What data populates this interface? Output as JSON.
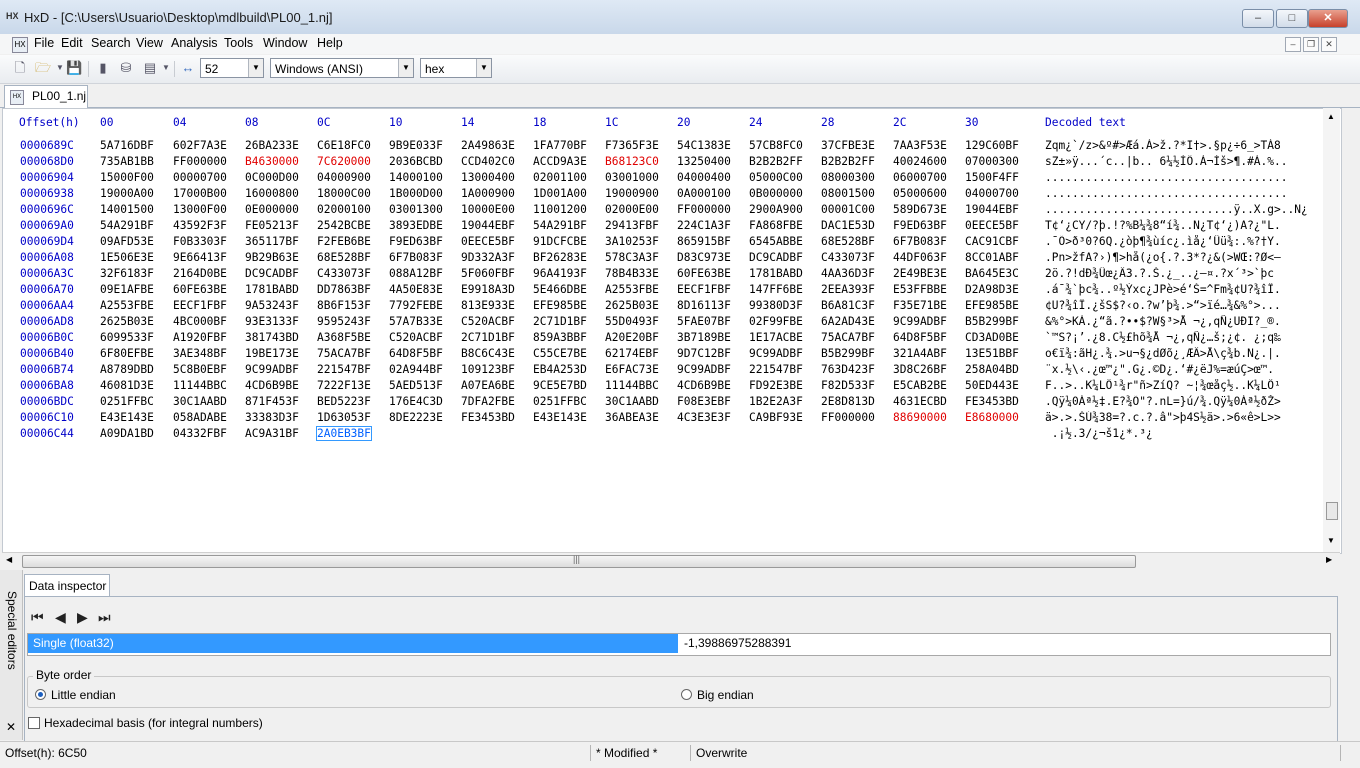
{
  "window": {
    "title": "HxD - [C:\\Users\\Usuario\\Desktop\\mdlbuild\\PL00_1.nj]",
    "minimize": "–",
    "maximize": "□",
    "close": "✕"
  },
  "menu": [
    "File",
    "Edit",
    "Search",
    "View",
    "Analysis",
    "Tools",
    "Window",
    "Help"
  ],
  "toolbar": {
    "bytes_per_row": "52",
    "charset": "Windows (ANSI)",
    "offset_base": "hex"
  },
  "tab": {
    "label": "PL00_1.nj"
  },
  "hex": {
    "offset_header": "Offset(h)",
    "column_headers": [
      "00",
      "04",
      "08",
      "0C",
      "10",
      "14",
      "18",
      "1C",
      "20",
      "24",
      "28",
      "2C",
      "30"
    ],
    "decoded_header": "Decoded text",
    "rows": [
      {
        "offset": "0000689C",
        "groups": [
          "5A716DBF",
          "602F7A3E",
          "26BA233E",
          "C6E18FC0",
          "9B9E033F",
          "2A49863E",
          "1FA770BF",
          "F7365F3E",
          "54C1383E",
          "57CB8FC0",
          "37CFBE3E",
          "7AA3F53E",
          "129C60BF"
        ],
        "decoded": "Zqm¿`/z>&º#>Æá.À>ž.?*I†>.§p¿÷6_>TÁ8",
        "red": []
      },
      {
        "offset": "000068D0",
        "groups": [
          "735AB1BB",
          "FF000000",
          "B4630000",
          "7C620000",
          "2036BCBD",
          "CCD402C0",
          "ACCD9A3E",
          "B68123C0",
          "13250400",
          "B2B2B2FF",
          "B2B2B2FF",
          "40024600",
          "07000300"
        ],
        "decoded": "sZ±»ÿ...´c..|b.. 6¼½ÌÔ.À¬Íš>¶.#À.%..",
        "red": [
          2,
          3,
          7
        ]
      },
      {
        "offset": "00006904",
        "groups": [
          "15000F00",
          "00000700",
          "0C000D00",
          "04000900",
          "14000100",
          "13000400",
          "02001100",
          "03001000",
          "04000400",
          "05000C00",
          "08000300",
          "06000700",
          "1500F4FF"
        ],
        "decoded": "....................................",
        "red": []
      },
      {
        "offset": "00006938",
        "groups": [
          "19000A00",
          "17000B00",
          "16000800",
          "18000C00",
          "1B000D00",
          "1A000900",
          "1D001A00",
          "19000900",
          "0A000100",
          "0B000000",
          "08001500",
          "05000600",
          "04000700"
        ],
        "decoded": "....................................",
        "red": []
      },
      {
        "offset": "0000696C",
        "groups": [
          "14001500",
          "13000F00",
          "0E000000",
          "02000100",
          "03001300",
          "10000E00",
          "11001200",
          "02000E00",
          "FF000000",
          "2900A900",
          "00001C00",
          "589D673E",
          "19044EBF"
        ],
        "decoded": "............................ÿ..X.g>..N¿",
        "red": []
      },
      {
        "offset": "000069A0",
        "groups": [
          "54A291BF",
          "43592F3F",
          "FE05213F",
          "2542BCBE",
          "3893EDBE",
          "19044EBF",
          "54A291BF",
          "29413FBF",
          "224C1A3F",
          "FA868FBE",
          "DAC1E53D",
          "F9ED63BF",
          "0EECE5BF"
        ],
        "decoded": "T¢‘¿CY/?þ.!?%B¼¾8“í¾..N¿T¢‘¿)A?¿\"L.",
        "red": []
      },
      {
        "offset": "000069D4",
        "groups": [
          "09AFD53E",
          "F0B3303F",
          "365117BF",
          "F2FEB6BE",
          "F9ED63BF",
          "0EECE5BF",
          "91DCFCBE",
          "3A10253F",
          "865915BF",
          "6545ABBE",
          "68E528BF",
          "6F7B083F",
          "CAC91CBF"
        ],
        "decoded": ".¯Õ>ð³0?6Q.¿òþ¶¾ùíc¿.ìå¿‘Üü¾:.%?†Y.",
        "red": []
      },
      {
        "offset": "00006A08",
        "groups": [
          "1E506E3E",
          "9E66413F",
          "9B29B63E",
          "68E528BF",
          "6F7B083F",
          "9D332A3F",
          "BF26283E",
          "578C3A3F",
          "D83C973E",
          "DC9CADBF",
          "C433073F",
          "44DF063F",
          "8CC01ABF"
        ],
        "decoded": ".Pn>žfA?›)¶>hå(¿o{.?.3*?¿&(>WŒ:?Ø<—",
        "red": []
      },
      {
        "offset": "00006A3C",
        "groups": [
          "32F6183F",
          "2164D0BE",
          "DC9CADBF",
          "C433073F",
          "088A12BF",
          "5F060FBF",
          "96A4193F",
          "78B4B33E",
          "60FE63BE",
          "1781BABD",
          "4AA36D3F",
          "2E49BE3E",
          "BA645E3C"
        ],
        "decoded": "2ö.?!dÐ¾Üœ­¿Ä3.?.Š.¿_..¿–¤.?x´³>`þc",
        "red": []
      },
      {
        "offset": "00006A70",
        "groups": [
          "09E1AFBE",
          "60FE63BE",
          "1781BABD",
          "DD7863BF",
          "4A50E83E",
          "E9918A3D",
          "5E466DBE",
          "A2553FBE",
          "EECF1FBF",
          "147FF6BE",
          "2EEA393F",
          "E53FFBBE",
          "D2A98D3E"
        ],
        "decoded": ".á¯¾`þc¾..º½Ýxc¿JPè>é‘Š=^Fm¾¢U?¾îÏ.",
        "red": []
      },
      {
        "offset": "00006AA4",
        "groups": [
          "A2553FBE",
          "EECF1FBF",
          "9A53243F",
          "8B6F153F",
          "7792FEBE",
          "813E933E",
          "EFE985BE",
          "2625B03E",
          "8D16113F",
          "99380D3F",
          "B6A81C3F",
          "F35E71BE",
          "EFE985BE"
        ],
        "decoded": "¢U?¾îÏ.¿šS$?‹o.?w’þ¾.>“>ïé…¾&%°>...",
        "red": []
      },
      {
        "offset": "00006AD8",
        "groups": [
          "2625B03E",
          "4BC000BF",
          "93E3133F",
          "9595243F",
          "57A7B33E",
          "C520ACBF",
          "2C71D1BF",
          "55D0493F",
          "5FAE07BF",
          "02F99FBE",
          "6A2AD43E",
          "9C99ADBF",
          "B5B299BF"
        ],
        "decoded": "&%°>KÀ.¿“ã.?••$?W§³>Å ¬¿,qÑ¿UÐI?_®.",
        "red": []
      },
      {
        "offset": "00006B0C",
        "groups": [
          "6099533F",
          "A1920FBF",
          "381743BD",
          "A368F5BE",
          "C520ACBF",
          "2C71D1BF",
          "859A3BBF",
          "A20E20BF",
          "3B7189BE",
          "1E17ACBE",
          "75ACA7BF",
          "64D8F5BF",
          "CD3AD0BE"
        ],
        "decoded": "`™S?¡’.¿8.C½£hõ¾Å ¬¿,qÑ¿…š;¿¢. ¿;q‰",
        "red": []
      },
      {
        "offset": "00006B40",
        "groups": [
          "6F80EFBE",
          "3AE348BF",
          "19BE173E",
          "75ACA7BF",
          "64D8F5BF",
          "B8C6C43E",
          "C55CE7BE",
          "62174EBF",
          "9D7C12BF",
          "9C99ADBF",
          "B5B299BF",
          "321A4ABF",
          "13E51BBF"
        ],
        "decoded": "o€ï¾:ãH¿.¾.>u¬§¿dØõ¿¸ÆÄ>Å\\ç¾b.N¿.|.",
        "red": []
      },
      {
        "offset": "00006B74",
        "groups": [
          "A8789DBD",
          "5C8B0EBF",
          "9C99ADBF",
          "221547BF",
          "02A944BF",
          "109123BF",
          "EB4A253D",
          "E6FAC73E",
          "9C99ADBF",
          "221547BF",
          "763D423F",
          "3D8C26BF",
          "258A04BD"
        ],
        "decoded": "¨x.½\\‹.¿œ™­¿\".G¿.©D¿.‘#¿ëJ%=æúÇ>œ™.",
        "red": []
      },
      {
        "offset": "00006BA8",
        "groups": [
          "46081D3E",
          "11144BBC",
          "4CD6B9BE",
          "7222F13E",
          "5AED513F",
          "A07EA6BE",
          "9CE5E7BD",
          "11144BBC",
          "4CD6B9BE",
          "FD92E3BE",
          "F82D533F",
          "E5CAB2BE",
          "50ED443E"
        ],
        "decoded": "F..>..K¼LÖ¹¾r\"ñ>ZíQ? ~¦¾œåç½..K¼LÖ¹",
        "red": []
      },
      {
        "offset": "00006BDC",
        "groups": [
          "0251FFBC",
          "30C1AABD",
          "871F453F",
          "BED5223F",
          "176E4C3D",
          "7DFA2FBE",
          "0251FFBC",
          "30C1AABD",
          "F08E3EBF",
          "1B2E2A3F",
          "2E8D813D",
          "4631ECBD",
          "FE3453BD"
        ],
        "decoded": ".Qÿ¼0Áª½‡.E?¾Õ\"?.nL=}ú/¾.Qÿ¼0Áª½ðŽ>",
        "red": []
      },
      {
        "offset": "00006C10",
        "groups": [
          "E43E143E",
          "058ADABE",
          "33383D3F",
          "1D63053F",
          "8DE2223E",
          "FE3453BD",
          "E43E143E",
          "36ABEA3E",
          "4C3E3E3F",
          "CA9BF93E",
          "FF000000",
          "88690000",
          "E8680000"
        ],
        "decoded": "ä>.>.ŠÚ¾38=?.c.?.â\">þ4S½ä>.>6«ê>L>>",
        "red": [
          11,
          12
        ]
      },
      {
        "offset": "00006C44",
        "groups": [
          "A09DA1BD",
          "04332FBF",
          "AC9A31BF",
          "2A0EB3BF"
        ],
        "decoded": " .¡½.3/¿¬š1¿*.³¿",
        "red": [],
        "selected": 3
      }
    ]
  },
  "inspector": {
    "special_editors": "Special editors",
    "tab_label": "Data inspector",
    "nav": [
      "⏮",
      "◀",
      "▶",
      "⏭"
    ],
    "type_label": "Single (float32)",
    "type_value": "-1,39886975288391",
    "byte_order_title": "Byte order",
    "little_endian": "Little endian",
    "big_endian": "Big endian",
    "hex_basis": "Hexadecimal basis (for integral numbers)",
    "close": "✕"
  },
  "status": {
    "offset": "Offset(h): 6C50",
    "modified": "* Modified *",
    "mode": "Overwrite"
  }
}
